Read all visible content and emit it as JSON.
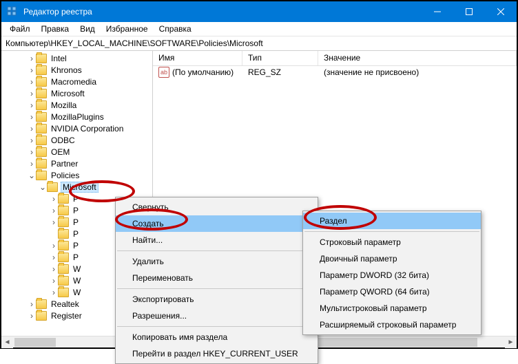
{
  "window": {
    "title": "Редактор реестра"
  },
  "menu": {
    "file": "Файл",
    "edit": "Правка",
    "view": "Вид",
    "favorites": "Избранное",
    "help": "Справка"
  },
  "address": "Компьютер\\HKEY_LOCAL_MACHINE\\SOFTWARE\\Policies\\Microsoft",
  "tree": {
    "items": [
      {
        "label": "Intel",
        "level": 1,
        "exp": "closed"
      },
      {
        "label": "Khronos",
        "level": 1,
        "exp": "closed"
      },
      {
        "label": "Macromedia",
        "level": 1,
        "exp": "closed"
      },
      {
        "label": "Microsoft",
        "level": 1,
        "exp": "closed"
      },
      {
        "label": "Mozilla",
        "level": 1,
        "exp": "closed"
      },
      {
        "label": "MozillaPlugins",
        "level": 1,
        "exp": "closed"
      },
      {
        "label": "NVIDIA Corporation",
        "level": 1,
        "exp": "closed"
      },
      {
        "label": "ODBC",
        "level": 1,
        "exp": "closed"
      },
      {
        "label": "OEM",
        "level": 1,
        "exp": "closed"
      },
      {
        "label": "Partner",
        "level": 1,
        "exp": "closed"
      },
      {
        "label": "Policies",
        "level": 1,
        "exp": "open"
      },
      {
        "label": "Microsoft",
        "level": 2,
        "exp": "open",
        "selected": true
      },
      {
        "label": "Р",
        "level": 3,
        "exp": "closed",
        "truncated": true
      },
      {
        "label": "Р",
        "level": 3,
        "exp": "closed",
        "truncated": true
      },
      {
        "label": "Р",
        "level": 3,
        "exp": "closed",
        "truncated": true
      },
      {
        "label": "Р",
        "level": 3,
        "exp": "none",
        "truncated": true
      },
      {
        "label": "Р",
        "level": 3,
        "exp": "closed",
        "truncated": true
      },
      {
        "label": "Р",
        "level": 3,
        "exp": "closed",
        "truncated": true
      },
      {
        "label": "W",
        "level": 3,
        "exp": "closed",
        "truncated": true
      },
      {
        "label": "W",
        "level": 3,
        "exp": "closed",
        "truncated": true
      },
      {
        "label": "W",
        "level": 3,
        "exp": "closed",
        "truncated": true
      },
      {
        "label": "Realtek",
        "level": 1,
        "exp": "closed"
      },
      {
        "label": "Register",
        "level": 1,
        "exp": "closed"
      }
    ]
  },
  "list": {
    "headers": {
      "name": "Имя",
      "type": "Тип",
      "value": "Значение"
    },
    "row": {
      "name": "(По умолчанию)",
      "type": "REG_SZ",
      "value": "(значение не присвоено)"
    }
  },
  "context": {
    "collapse": "Свернуть",
    "create": "Создать",
    "find": "Найти...",
    "delete": "Удалить",
    "rename": "Переименовать",
    "export": "Экспортировать",
    "permissions": "Разрешения...",
    "copyname": "Копировать имя раздела",
    "gotohkcu": "Перейти в раздел HKEY_CURRENT_USER"
  },
  "submenu": {
    "key": "Раздел",
    "string": "Строковый параметр",
    "binary": "Двоичный параметр",
    "dword": "Параметр DWORD (32 бита)",
    "qword": "Параметр QWORD (64 бита)",
    "multi": "Мультистроковый параметр",
    "expand": "Расширяемый строковый параметр"
  }
}
